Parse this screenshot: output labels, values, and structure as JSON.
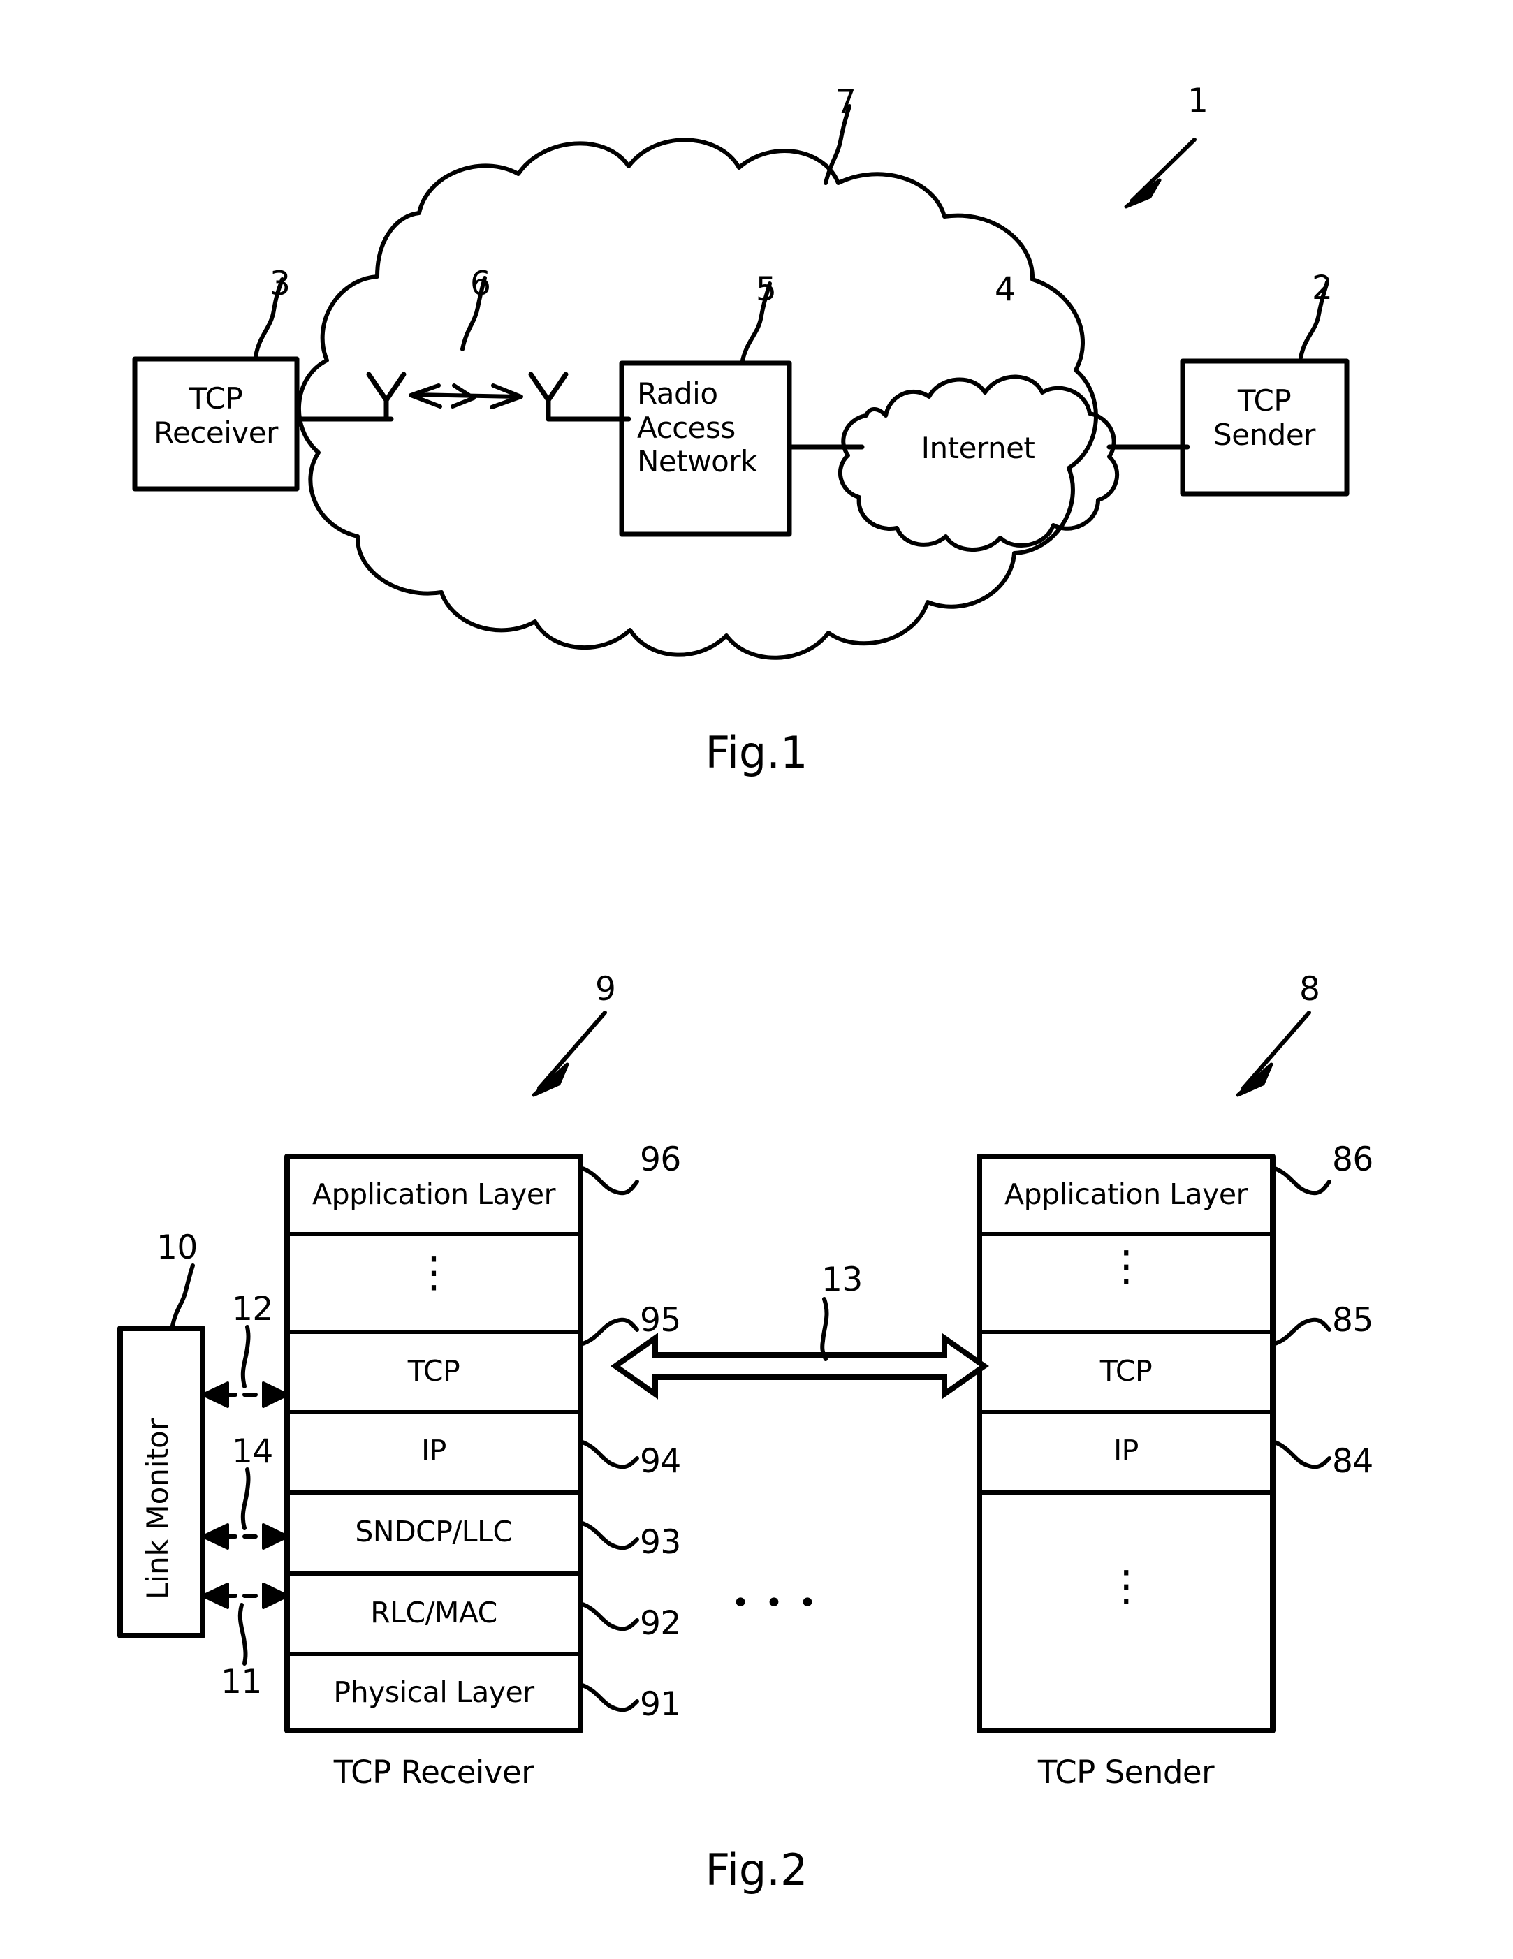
{
  "figure1": {
    "caption": "Fig.1",
    "nodes": {
      "tcp_receiver": "TCP\nReceiver",
      "tcp_receiver_line1": "TCP",
      "tcp_receiver_line2": "Receiver",
      "radio_access_network_line1": "Radio",
      "radio_access_network_line2": "Access",
      "radio_access_network_line3": "Network",
      "internet": "Internet",
      "tcp_sender_line1": "TCP",
      "tcp_sender_line2": "Sender"
    },
    "reference_numbers": {
      "system": "1",
      "tcp_sender": "2",
      "tcp_receiver": "3",
      "internet": "4",
      "radio_access_network": "5",
      "radio_link": "6",
      "network_cloud": "7"
    }
  },
  "figure2": {
    "caption": "Fig.2",
    "receiver": {
      "title": "TCP Receiver",
      "stack_ref": "9",
      "layers": [
        {
          "label": "Application Layer",
          "ref": "96"
        },
        {
          "label": "⋮",
          "ref": ""
        },
        {
          "label": "TCP",
          "ref": "95"
        },
        {
          "label": "IP",
          "ref": "94"
        },
        {
          "label": "SNDCP/LLC",
          "ref": "93"
        },
        {
          "label": "RLC/MAC",
          "ref": "92"
        },
        {
          "label": "Physical Layer",
          "ref": "91"
        }
      ]
    },
    "sender": {
      "title": "TCP Sender",
      "stack_ref": "8",
      "layers": [
        {
          "label": "Application Layer",
          "ref": "86"
        },
        {
          "label": "⋮",
          "ref": ""
        },
        {
          "label": "TCP",
          "ref": "85"
        },
        {
          "label": "IP",
          "ref": "84"
        },
        {
          "label": "⋮",
          "ref": ""
        }
      ]
    },
    "link_monitor": {
      "label": "Link Monitor",
      "ref": "10",
      "connections": [
        {
          "ref": "12",
          "target": "TCP"
        },
        {
          "ref": "14",
          "target": "SNDCP/LLC"
        },
        {
          "ref": "11",
          "target": "RLC/MAC"
        }
      ]
    },
    "connection_arrow_ref": "13",
    "ellipsis": "• • •"
  },
  "colors": {
    "ink": "#000000",
    "paper": "#ffffff"
  }
}
